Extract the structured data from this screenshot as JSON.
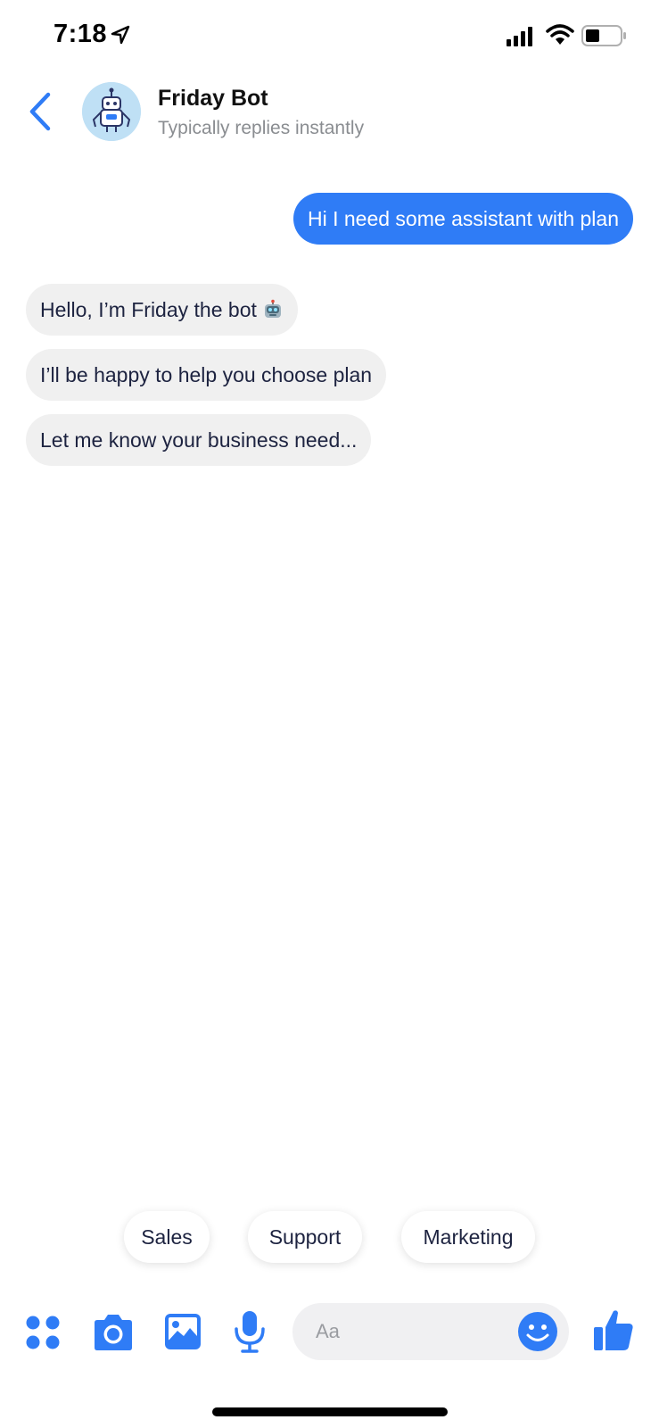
{
  "status_bar": {
    "time": "7:18"
  },
  "header": {
    "name": "Friday Bot",
    "status": "Typically replies instantly"
  },
  "messages": {
    "outgoing": [
      "Hi I need some assistant with plan"
    ],
    "incoming": [
      "Hello, I’m Friday the bot",
      "I’ll be happy to help you choose plan",
      "Let me know your business need..."
    ]
  },
  "quick_replies": [
    "Sales",
    "Support",
    "Marketing"
  ],
  "composer": {
    "placeholder": "Aa"
  },
  "colors": {
    "accent": "#2f7cf6",
    "incoming_bubble": "#f0f0f0",
    "text_dark": "#1d2340"
  }
}
